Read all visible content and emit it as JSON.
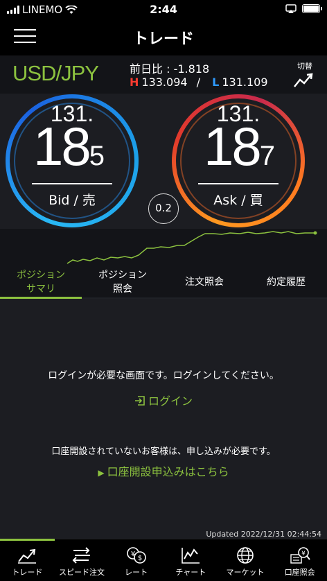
{
  "status": {
    "carrier": "LINEMO",
    "time": "2:44"
  },
  "header": {
    "title": "トレード"
  },
  "pair": {
    "name": "USD/JPY",
    "change": "前日比 : -1.818",
    "high_label": "H",
    "high_value": "133.094",
    "separator": "/",
    "low_label": "L",
    "low_value": "131.109",
    "switch_label": "切替"
  },
  "bid": {
    "big_figure": "131.",
    "pips": "18",
    "fraction": "5",
    "label": "Bid / 売"
  },
  "ask": {
    "big_figure": "131.",
    "pips": "18",
    "fraction": "7",
    "label": "Ask / 買"
  },
  "spread": "0.2",
  "tabs": [
    {
      "label_line1": "ポジション",
      "label_line2": "サマリ"
    },
    {
      "label_line1": "ポジション",
      "label_line2": "照会"
    },
    {
      "label_line1": "注文照会",
      "label_line2": ""
    },
    {
      "label_line1": "約定履歴",
      "label_line2": ""
    }
  ],
  "content": {
    "login_message": "ログインが必要な画面です。ログインしてください。",
    "login_link": "ログイン",
    "account_message": "口座開設されていないお客様は、申し込みが必要です。",
    "account_link": "口座開設申込みはこちら",
    "updated": "Updated  2022/12/31 02:44:54"
  },
  "nav": [
    {
      "label": "トレード",
      "icon": "trend-chart-icon"
    },
    {
      "label": "スピード注文",
      "icon": "speed-order-icon"
    },
    {
      "label": "レート",
      "icon": "rate-icon"
    },
    {
      "label": "チャート",
      "icon": "chart-icon"
    },
    {
      "label": "マーケット",
      "icon": "globe-icon"
    },
    {
      "label": "口座照会",
      "icon": "account-icon"
    }
  ],
  "colors": {
    "accent": "#8cc23f",
    "high": "#ff3b30",
    "low": "#2f9bff"
  }
}
